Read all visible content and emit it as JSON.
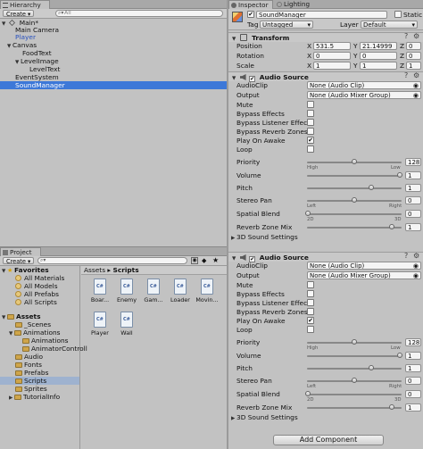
{
  "hierarchy": {
    "tab_label": "Hierarchy",
    "create_label": "Create",
    "search_placeholder": "All",
    "scene_name": "Main*",
    "items": [
      "Main Camera",
      "Player",
      "Canvas",
      "FoodText",
      "LevelImage",
      "LevelText",
      "EventSystem",
      "SoundManager"
    ]
  },
  "project": {
    "tab_label": "Project",
    "create_label": "Create",
    "breadcrumb_root": "Assets",
    "breadcrumb_sep": "▸",
    "breadcrumb_current": "Scripts",
    "favorites_label": "Favorites",
    "favorites": [
      "All Materials",
      "All Models",
      "All Prefabs",
      "All Scripts"
    ],
    "assets_label": "Assets",
    "folders": [
      "_Scenes",
      "Animations",
      "Animations",
      "AnimatorControll",
      "Audio",
      "Fonts",
      "Prefabs",
      "Scripts",
      "Sprites",
      "TutorialInfo"
    ],
    "scripts": [
      "Boar...",
      "Enemy",
      "Gam...",
      "Loader",
      "Movin...",
      "Player",
      "Wall"
    ]
  },
  "inspector": {
    "tab_label": "Inspector",
    "lighting_tab": "Lighting",
    "object_name": "SoundManager",
    "static_label": "Static",
    "tag_label": "Tag",
    "tag_value": "Untagged",
    "layer_label": "Layer",
    "layer_value": "Default",
    "transform": {
      "title": "Transform",
      "position_label": "Position",
      "rotation_label": "Rotation",
      "scale_label": "Scale",
      "x": "X",
      "y": "Y",
      "z": "Z",
      "position": [
        "531.5",
        "21.14999",
        "0"
      ],
      "rotation": [
        "0",
        "0",
        "0"
      ],
      "scale": [
        "1",
        "1",
        "1"
      ]
    },
    "audio_sources": [
      {
        "title": "Audio Source",
        "audioclip_label": "AudioClip",
        "audioclip_value": "None (Audio Clip)",
        "output_label": "Output",
        "output_value": "None (Audio Mixer Group)",
        "mute": "Mute",
        "bypass_effects": "Bypass Effects",
        "bypass_listener": "Bypass Listener Effects",
        "bypass_reverb": "Bypass Reverb Zones",
        "play_on_awake": "Play On Awake",
        "loop": "Loop",
        "priority_label": "Priority",
        "priority_value": "128",
        "priority_level": 0.5,
        "high": "High",
        "low": "Low",
        "volume_label": "Volume",
        "volume_value": "1",
        "pitch_label": "Pitch",
        "pitch_value": "1",
        "stereo_label": "Stereo Pan",
        "stereo_value": "0",
        "left": "Left",
        "right": "Right",
        "spatial_label": "Spatial Blend",
        "spatial_value": "0",
        "two_d": "2D",
        "three_d": "3D",
        "reverb_label": "Reverb Zone Mix",
        "reverb_value": "1",
        "settings_label": "3D Sound Settings"
      },
      {
        "title": "Audio Source",
        "audioclip_label": "AudioClip",
        "audioclip_value": "None (Audio Clip)",
        "output_label": "Output",
        "output_value": "None (Audio Mixer Group)",
        "mute": "Mute",
        "bypass_effects": "Bypass Effects",
        "bypass_listener": "Bypass Listener Effects",
        "bypass_reverb": "Bypass Reverb Zones",
        "play_on_awake": "Play On Awake",
        "loop": "Loop",
        "priority_label": "Priority",
        "priority_value": "128",
        "priority_level": 0.5,
        "high": "High",
        "low": "Low",
        "volume_label": "Volume",
        "volume_value": "1",
        "pitch_label": "Pitch",
        "pitch_value": "1",
        "stereo_label": "Stereo Pan",
        "stereo_value": "0",
        "left": "Left",
        "right": "Right",
        "spatial_label": "Spatial Blend",
        "spatial_value": "0",
        "two_d": "2D",
        "three_d": "3D",
        "reverb_label": "Reverb Zone Mix",
        "reverb_value": "1",
        "settings_label": "3D Sound Settings"
      }
    ],
    "add_component_label": "Add Component"
  },
  "colors": {
    "selection": "#3d78d8",
    "panel": "#c2c2c2",
    "link_blue": "#2a52be"
  }
}
